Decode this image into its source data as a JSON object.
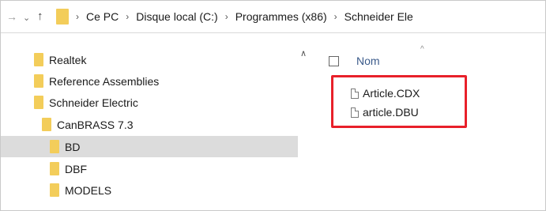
{
  "address_bar": {
    "back_icon": "arrow-left-icon",
    "recent_icon": "chevron-down-icon",
    "up_icon": "arrow-up-icon",
    "separator": "›",
    "breadcrumbs": [
      "Ce PC",
      "Disque local (C:)",
      "Programmes (x86)",
      "Schneider Ele"
    ]
  },
  "nav_pane": {
    "items": [
      {
        "label": "Realtek",
        "indent": 0,
        "selected": false
      },
      {
        "label": "Reference Assemblies",
        "indent": 0,
        "selected": false
      },
      {
        "label": "Schneider Electric",
        "indent": 0,
        "selected": false
      },
      {
        "label": "CanBRASS 7.3",
        "indent": 1,
        "selected": false
      },
      {
        "label": "BD",
        "indent": 2,
        "selected": true
      },
      {
        "label": "DBF",
        "indent": 2,
        "selected": false
      },
      {
        "label": "MODELS",
        "indent": 2,
        "selected": false
      }
    ]
  },
  "content": {
    "column_header": "Nom",
    "sort_indicator": "^",
    "files": [
      "Article.CDX",
      "article.DBU"
    ]
  },
  "colors": {
    "folder": "#f3cd5a",
    "selection": "#dcdcdc",
    "highlight_border": "#e8202a",
    "header_text": "#3a5a8a"
  }
}
